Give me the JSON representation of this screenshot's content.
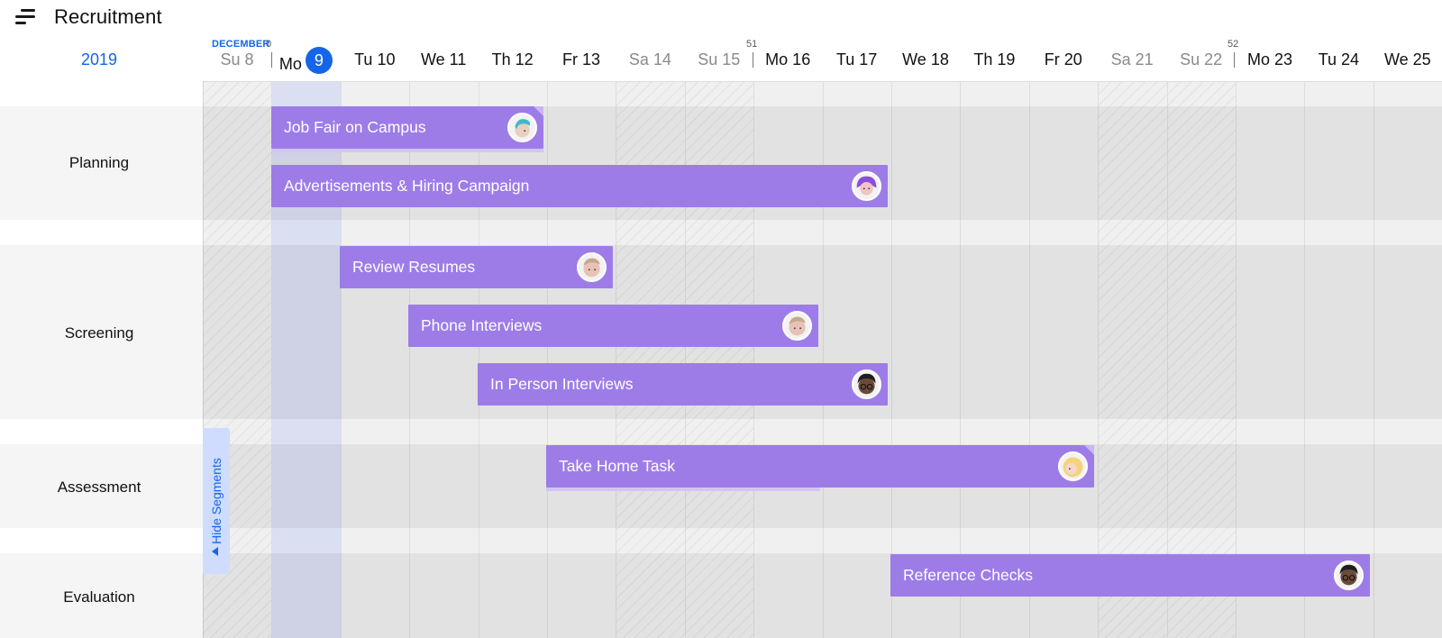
{
  "app": {
    "title": "Recruitment"
  },
  "timeline": {
    "year": "2019",
    "month": "DECEMBER",
    "week_numbers": [
      "0",
      "51",
      "52"
    ],
    "days": [
      {
        "label": "Su 8",
        "weekend": true
      },
      {
        "label": "Mo",
        "day": "9",
        "today": true
      },
      {
        "label": "Tu 10"
      },
      {
        "label": "We 11"
      },
      {
        "label": "Th 12"
      },
      {
        "label": "Fr 13"
      },
      {
        "label": "Sa 14",
        "weekend": true
      },
      {
        "label": "Su 15",
        "weekend": true
      },
      {
        "label": "Mo 16"
      },
      {
        "label": "Tu 17"
      },
      {
        "label": "We 18"
      },
      {
        "label": "Th 19"
      },
      {
        "label": "Fr 20"
      },
      {
        "label": "Sa 21",
        "weekend": true
      },
      {
        "label": "Su 22",
        "weekend": true
      },
      {
        "label": "Mo 23"
      },
      {
        "label": "Tu 24"
      },
      {
        "label": "We 25"
      }
    ]
  },
  "rows": [
    {
      "label": "Planning"
    },
    {
      "label": "Screening"
    },
    {
      "label": "Assessment"
    },
    {
      "label": "Evaluation"
    }
  ],
  "tasks": [
    {
      "name": "Job Fair on Campus",
      "avatar": "avatar-teal-hair",
      "progress": 1.0
    },
    {
      "name": "Advertisements & Hiring Campaign",
      "avatar": "avatar-purple-hair"
    },
    {
      "name": "Review Resumes",
      "avatar": "avatar-beige"
    },
    {
      "name": "Phone Interviews",
      "avatar": "avatar-beige"
    },
    {
      "name": "In Person Interviews",
      "avatar": "avatar-dark-glasses"
    },
    {
      "name": "Take Home Task",
      "avatar": "avatar-blonde",
      "progress": 0.5
    },
    {
      "name": "Reference Checks",
      "avatar": "avatar-dark-glasses"
    }
  ],
  "controls": {
    "hide_segments": "Hide Segments"
  },
  "colors": {
    "accent": "#1565e8",
    "task": "#9d7ce8",
    "weekend_text": "#8a8a8a"
  }
}
